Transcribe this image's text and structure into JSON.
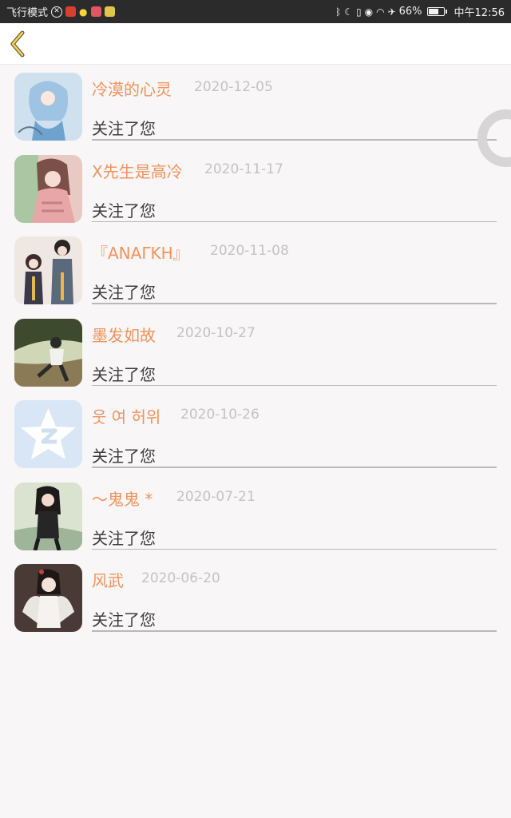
{
  "status_bar": {
    "airplane_mode": "飞行模式",
    "battery": "66%",
    "time": "中午12:56",
    "icons": [
      "close-circle-icon",
      "app-icon",
      "bulb-icon",
      "app-icon",
      "app-icon",
      "bluetooth-icon",
      "moon-icon",
      "vibrate-icon",
      "eye-icon",
      "wifi-icon",
      "airplane-icon",
      "battery-icon"
    ]
  },
  "header": {
    "back_icon": "chevron-left-icon"
  },
  "items": [
    {
      "name": "冷漠的心灵",
      "date": "2020-12-05",
      "action": "关注了您",
      "avatar_color": "#cfe0ee"
    },
    {
      "name": "X先生是高冷",
      "date": "2020-11-17",
      "action": "关注了您",
      "avatar_color": "#e8c9c4"
    },
    {
      "name": "『ΑΝΑΓΚΗ』",
      "date": "2020-11-08",
      "action": "关注了您",
      "avatar_color": "#efe7e2"
    },
    {
      "name": "墨发如故",
      "date": "2020-10-27",
      "action": "关注了您",
      "avatar_color": "#8a7a55"
    },
    {
      "name": "웃 여 허위",
      "date": "2020-10-26",
      "action": "关注了您",
      "avatar_color": "#d8e6f5"
    },
    {
      "name": "～鬼鬼 *",
      "date": "2020-07-21",
      "action": "关注了您",
      "avatar_color": "#9fb59a"
    },
    {
      "name": "风武",
      "date": "2020-06-20",
      "action": "关注了您",
      "avatar_color": "#4a3a35"
    }
  ],
  "colors": {
    "name": "#f0935b",
    "date": "#c3c3c3",
    "action": "#3e3e3e",
    "divider": "#b9b9b9"
  }
}
